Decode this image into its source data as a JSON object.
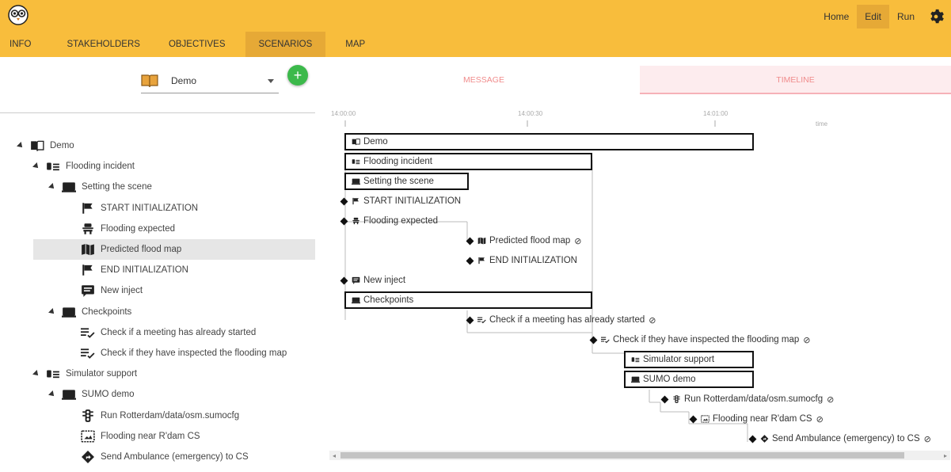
{
  "app": {
    "logo_icon": "owl-logo-icon",
    "accent": "#f8bd3c",
    "accent_dark": "#e6a936"
  },
  "header": {
    "links": [
      {
        "label": "Home"
      },
      {
        "label": "Edit"
      },
      {
        "label": "Run"
      }
    ],
    "settings_icon": "gear-icon"
  },
  "menu": {
    "tabs": [
      {
        "label": "INFO"
      },
      {
        "label": "STAKEHOLDERS"
      },
      {
        "label": "OBJECTIVES"
      },
      {
        "label": "SCENARIOS"
      },
      {
        "label": "MAP"
      }
    ],
    "active": "SCENARIOS"
  },
  "scenario_select": {
    "value": "Demo",
    "icon": "book-icon",
    "add_label": "+"
  },
  "tree": [
    {
      "label": "Demo",
      "icon": "book-icon",
      "level": 0,
      "expanded": true
    },
    {
      "label": "Flooding incident",
      "icon": "storyline-icon",
      "level": 1,
      "expanded": true
    },
    {
      "label": "Setting the scene",
      "icon": "act-icon",
      "level": 2,
      "expanded": true
    },
    {
      "label": "START INITIALIZATION",
      "icon": "flag-icon",
      "level": 3
    },
    {
      "label": "Flooding expected",
      "icon": "person-icon",
      "level": 3
    },
    {
      "label": "Predicted flood map",
      "icon": "map-icon",
      "level": 3,
      "selected": true
    },
    {
      "label": "END INITIALIZATION",
      "icon": "flag-icon",
      "level": 3
    },
    {
      "label": "New inject",
      "icon": "message-icon",
      "level": 3
    },
    {
      "label": "Checkpoints",
      "icon": "act-icon",
      "level": 2,
      "expanded": true
    },
    {
      "label": "Check if a meeting has already started",
      "icon": "checklist-icon",
      "level": 3
    },
    {
      "label": "Check if they have inspected the flooding map",
      "icon": "checklist-icon",
      "level": 3
    },
    {
      "label": "Simulator support",
      "icon": "storyline-icon",
      "level": 1,
      "expanded": true
    },
    {
      "label": "SUMO demo",
      "icon": "act-icon",
      "level": 2,
      "expanded": true
    },
    {
      "label": "Run Rotterdam/data/osm.sumocfg",
      "icon": "traffic-light-icon",
      "level": 3
    },
    {
      "label": "Flooding near R'dam CS",
      "icon": "image-icon",
      "level": 3
    },
    {
      "label": "Send Ambulance (emergency) to CS",
      "icon": "direction-icon",
      "level": 3
    }
  ],
  "view_tabs": [
    {
      "label": "MESSAGE"
    },
    {
      "label": "TIMELINE"
    }
  ],
  "timeline": {
    "ticks": [
      "14:00:00",
      "14:00:30",
      "14:01:00"
    ],
    "axis_label": "time",
    "no_op_symbol": "⊘",
    "items": [
      {
        "label": "Demo",
        "icon": "book-icon"
      },
      {
        "label": "Flooding incident",
        "icon": "storyline-icon"
      },
      {
        "label": "Setting the scene",
        "icon": "act-icon"
      },
      {
        "label": "START INITIALIZATION",
        "icon": "flag-icon"
      },
      {
        "label": "Flooding expected",
        "icon": "person-icon"
      },
      {
        "label": "Predicted flood map",
        "icon": "map-icon",
        "noop": true
      },
      {
        "label": "END INITIALIZATION",
        "icon": "flag-icon"
      },
      {
        "label": "New inject",
        "icon": "message-icon"
      },
      {
        "label": "Checkpoints",
        "icon": "act-icon"
      },
      {
        "label": "Check if a meeting has already started",
        "icon": "checklist-icon",
        "noop": true
      },
      {
        "label": "Check if they have inspected the flooding map",
        "icon": "checklist-icon",
        "noop": true
      },
      {
        "label": "Simulator support",
        "icon": "storyline-icon"
      },
      {
        "label": "SUMO demo",
        "icon": "act-icon"
      },
      {
        "label": "Run Rotterdam/data/osm.sumocfg",
        "icon": "traffic-light-icon",
        "noop": true
      },
      {
        "label": "Flooding near R'dam CS",
        "icon": "image-icon",
        "noop": true
      },
      {
        "label": "Send Ambulance (emergency) to CS",
        "icon": "direction-icon",
        "noop": true
      }
    ]
  },
  "scroll": {
    "left_arrow": "◂",
    "right_arrow": "▸"
  }
}
